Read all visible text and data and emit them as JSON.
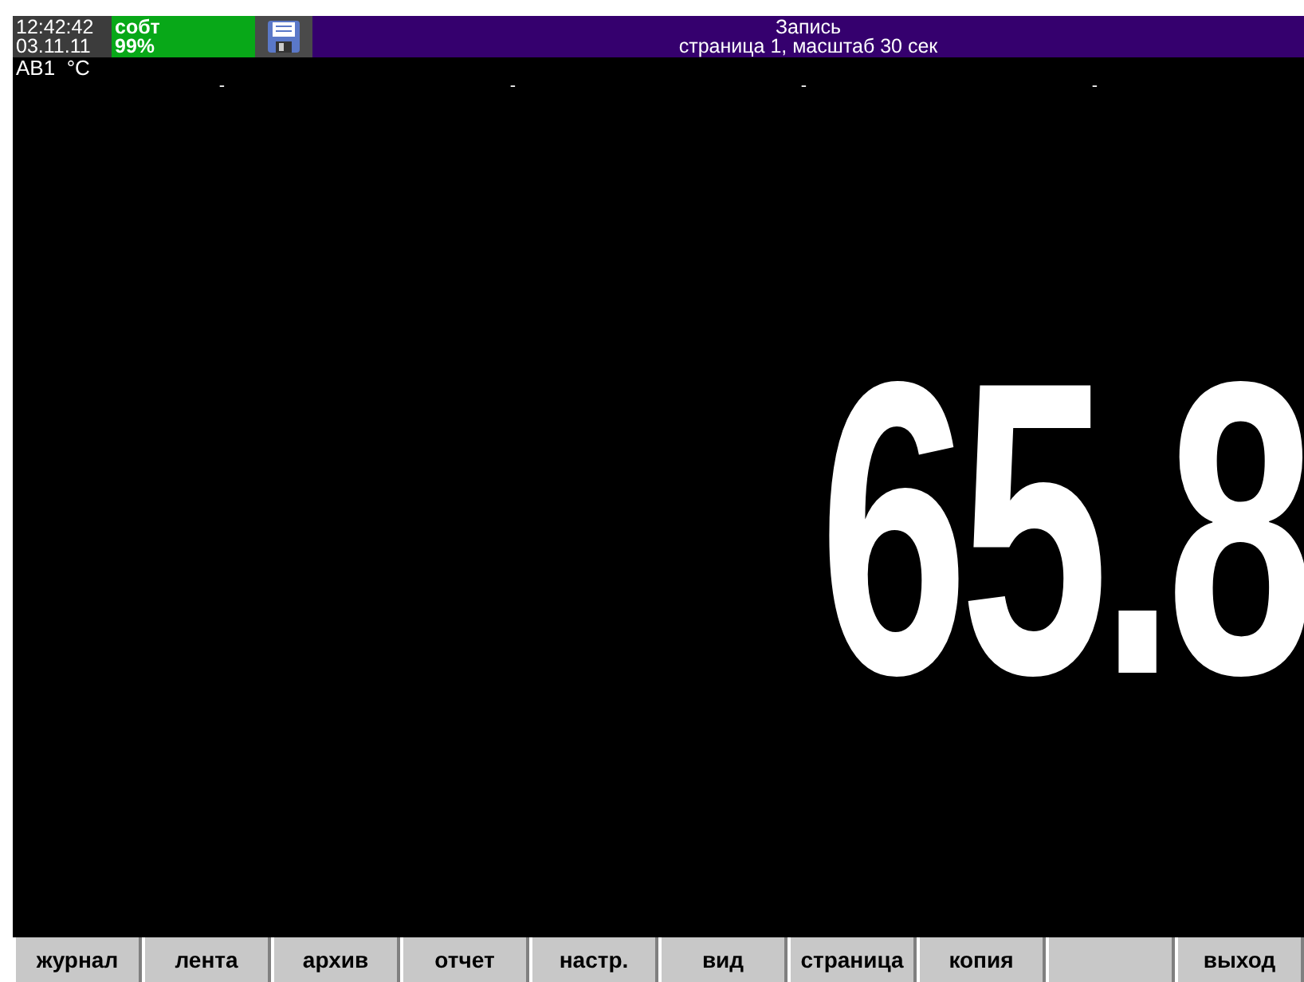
{
  "status": {
    "time": "12:42:42",
    "date": "03.11.11",
    "mode": "собт",
    "battery": "99%"
  },
  "header": {
    "title": "Запись",
    "subtitle": "страница 1, масштаб 30 сек"
  },
  "channel": {
    "name": "АВ1",
    "unit": "°C",
    "value": "65.8"
  },
  "scale_marks": [
    "-",
    "-",
    "-",
    "-"
  ],
  "buttons": [
    {
      "kind": "key",
      "label": "журнал"
    },
    {
      "kind": "key",
      "label": "лента"
    },
    {
      "kind": "key",
      "label": "архив"
    },
    {
      "kind": "key",
      "label": "отчет"
    },
    {
      "kind": "key",
      "label": "настр."
    },
    {
      "kind": "key",
      "label": "вид"
    },
    {
      "kind": "key",
      "label": "страница"
    },
    {
      "kind": "key",
      "label": "копия"
    },
    {
      "kind": "blank"
    },
    {
      "kind": "key",
      "label": "выход"
    }
  ]
}
